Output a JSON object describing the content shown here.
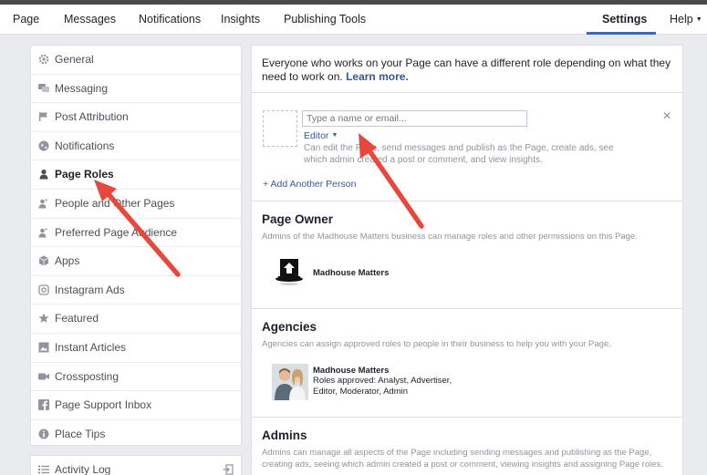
{
  "topnav": {
    "tabs": [
      "Page",
      "Messages",
      "Notifications",
      "Insights",
      "Publishing Tools"
    ],
    "settings_label": "Settings",
    "help_label": "Help"
  },
  "sidebar": {
    "items": [
      {
        "label": "General",
        "icon": "gear-icon"
      },
      {
        "label": "Messaging",
        "icon": "chat-bubbles-icon"
      },
      {
        "label": "Post Attribution",
        "icon": "flag-icon"
      },
      {
        "label": "Notifications",
        "icon": "globe-icon"
      },
      {
        "label": "Page Roles",
        "icon": "person-icon",
        "active": true
      },
      {
        "label": "People and Other Pages",
        "icon": "people-icon"
      },
      {
        "label": "Preferred Page Audience",
        "icon": "people-icon"
      },
      {
        "label": "Apps",
        "icon": "cube-icon"
      },
      {
        "label": "Instagram Ads",
        "icon": "instagram-icon"
      },
      {
        "label": "Featured",
        "icon": "star-icon"
      },
      {
        "label": "Instant Articles",
        "icon": "article-icon"
      },
      {
        "label": "Crossposting",
        "icon": "video-camera-icon"
      },
      {
        "label": "Page Support Inbox",
        "icon": "facebook-icon"
      },
      {
        "label": "Place Tips",
        "icon": "info-icon"
      }
    ],
    "activity_log_label": "Activity Log"
  },
  "intro": {
    "text": "Everyone who works on your Page can have a different role depending on what they need to work on.",
    "link": "Learn more."
  },
  "assign": {
    "placeholder": "Type a name or email...",
    "role": "Editor",
    "role_desc": "Can edit the Page, send messages and publish as the Page, create ads, see which admin created a post or comment, and view insights.",
    "add_person": "+ Add Another Person"
  },
  "page_owner": {
    "title": "Page Owner",
    "desc": "Admins of the Madhouse Matters business can manage roles and other permissions on this Page.",
    "name": "Madhouse Matters"
  },
  "agencies": {
    "title": "Agencies",
    "desc": "Agencies can assign approved roles to people in their business to help you with your Page.",
    "name": "Madhouse Matters",
    "roles_line1": "Roles approved: Analyst, Advertiser,",
    "roles_line2": "Editor, Moderator, Admin"
  },
  "admins": {
    "title": "Admins",
    "desc": "Admins can manage all aspects of the Page including sending messages and publishing as the Page, creating ads, seeing which admin created a post or comment, viewing insights and assigning Page roles."
  },
  "colors": {
    "link": "#365899",
    "accent": "#4267b2",
    "annotation_arrow": "#e8473c"
  }
}
